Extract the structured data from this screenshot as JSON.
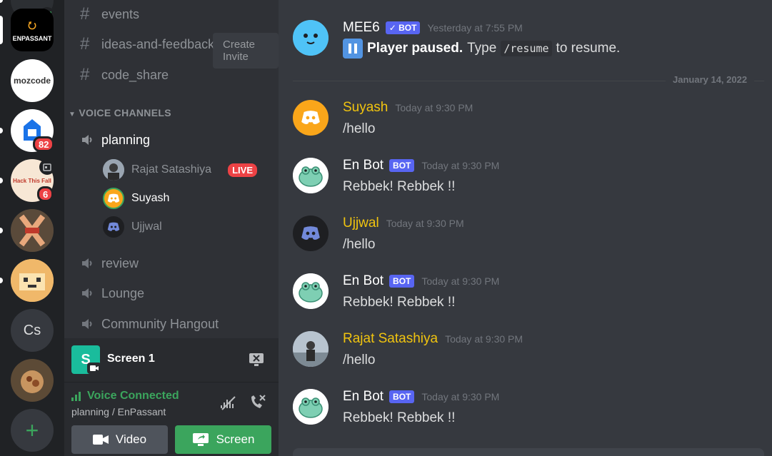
{
  "rail": {
    "servers": [
      {
        "label": "ENPASSANT"
      },
      {
        "label": "mozcode"
      },
      {
        "label": "",
        "badge": "82"
      },
      {
        "label": "Hack This Fall",
        "badge": "6"
      },
      {
        "label": ""
      },
      {
        "label": ""
      },
      {
        "label": "Cs"
      },
      {
        "label": ""
      }
    ],
    "add_label": "+"
  },
  "sidebar": {
    "text_channels": [
      "events",
      "ideas-and-feedback",
      "code_share"
    ],
    "category_label": "VOICE CHANNELS",
    "voice_channels": [
      "planning",
      "review",
      "Lounge",
      "Community Hangout"
    ],
    "voice_users": [
      {
        "name": "Rajat Satashiya",
        "live": "LIVE"
      },
      {
        "name": "Suyash"
      },
      {
        "name": "Ujjwal"
      }
    ],
    "tooltip": "Create Invite"
  },
  "screen_panel": {
    "avatar_letter": "S",
    "title": "Screen 1"
  },
  "voice_panel": {
    "status": "Voice Connected",
    "location": "planning / EnPassant",
    "video_label": "Video",
    "screen_label": "Screen"
  },
  "chat": {
    "date_divider": "January 14, 2022",
    "messages": [
      {
        "author": "MEE6",
        "bot_tag": "BOT",
        "time": "Yesterday at 7:55 PM",
        "bold": "Player paused.",
        "pre": "Type",
        "code": "/resume",
        "post": "to resume."
      },
      {
        "author": "Suyash",
        "time": "Today at 9:30 PM",
        "text": "/hello"
      },
      {
        "author": "En Bot",
        "bot_tag": "BOT",
        "time": "Today at 9:30 PM",
        "text": "Rebbek! Rebbek !!"
      },
      {
        "author": "Ujjwal",
        "time": "Today at 9:30 PM",
        "text": "/hello"
      },
      {
        "author": "En Bot",
        "bot_tag": "BOT",
        "time": "Today at 9:30 PM",
        "text": "Rebbek! Rebbek !!"
      },
      {
        "author": "Rajat Satashiya",
        "time": "Today at 9:30 PM",
        "text": "/hello"
      },
      {
        "author": "En Bot",
        "bot_tag": "BOT",
        "time": "Today at 9:30 PM",
        "text": "Rebbek! Rebbek !!"
      }
    ]
  },
  "colors": {
    "accent": "#5865f2",
    "voice_green": "#3ba55d",
    "username_gold": "#f1c40f",
    "live_red": "#ed4245"
  }
}
